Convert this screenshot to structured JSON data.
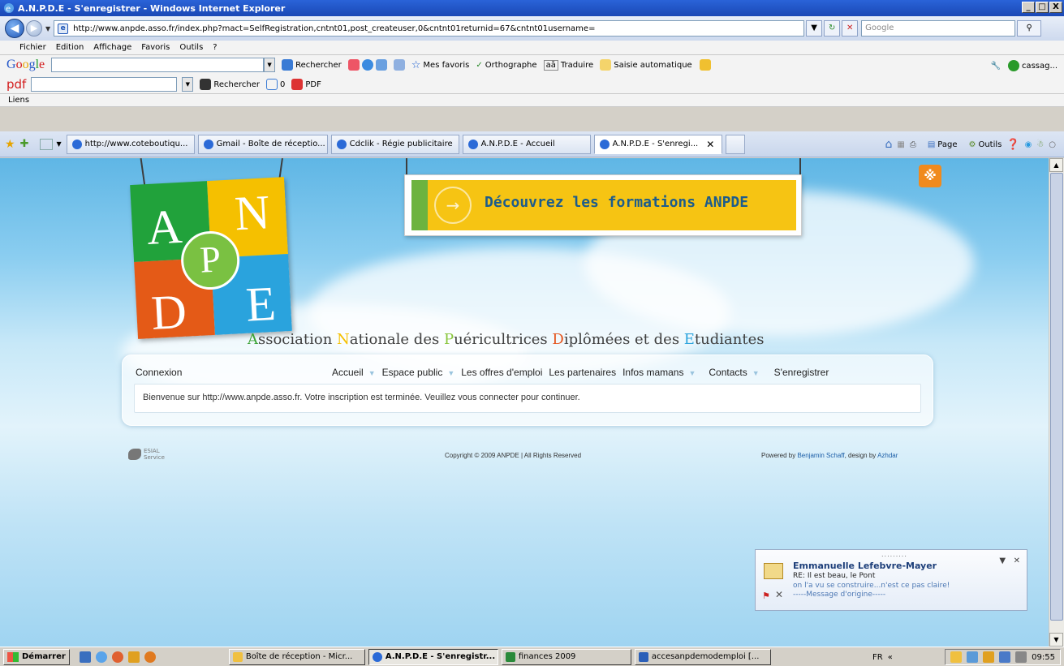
{
  "window": {
    "title": "A.N.P.D.E - S'enregistrer - Windows Internet Explorer",
    "controls": [
      "_",
      "□",
      "X"
    ]
  },
  "address": {
    "url": "http://www.anpde.asso.fr/index.php?mact=SelfRegistration,cntnt01,post_createuser,0&cntnt01returnid=67&cntnt01username=",
    "search_placeholder": "Google"
  },
  "menu": [
    "Fichier",
    "Edition",
    "Affichage",
    "Favoris",
    "Outils",
    "?"
  ],
  "google_toolbar": {
    "search_label": "Rechercher",
    "favorites_label": "Mes favoris",
    "spell_label": "Orthographe",
    "translate_label": "Traduire",
    "autofill_label": "Saisie automatique",
    "account_label": "cassag..."
  },
  "pdf_toolbar": {
    "brand": "pdf",
    "search_label": "Rechercher",
    "count": "0",
    "pdf_label": "PDF"
  },
  "links_label": "Liens",
  "tabs": [
    {
      "label": "http://www.coteboutiqu..."
    },
    {
      "label": "Gmail - Boîte de réceptio..."
    },
    {
      "label": "Cdclik - Régie publicitaire"
    },
    {
      "label": "A.N.P.D.E - Accueil"
    },
    {
      "label": "A.N.P.D.E - S'enregi..."
    }
  ],
  "command_bar": {
    "page_label": "Page",
    "tools_label": "Outils"
  },
  "page": {
    "logo_letters": {
      "a": "A",
      "n": "N",
      "p": "P",
      "d": "D",
      "e": "E"
    },
    "banner_text": "Découvrez les formations ANPDE",
    "title_parts": {
      "p1_initial": "A",
      "p1_rest": "ssociation ",
      "p2_initial": "N",
      "p2_rest": "ationale des ",
      "p3_initial": "P",
      "p3_rest": "uéricultrices ",
      "p4_initial": "D",
      "p4_rest": "iplômées et des ",
      "p5_initial": "E",
      "p5_rest": "tudiantes"
    },
    "connexion_label": "Connexion",
    "nav": {
      "accueil": "Accueil",
      "espace_public": "Espace public",
      "offres": "Les offres d'emploi",
      "partenaires": "Les partenaires",
      "infos": "Infos mamans",
      "contacts": "Contacts",
      "enregistrer": "S'enregistrer"
    },
    "message": "Bienvenue sur http://www.anpde.asso.fr. Votre inscription est terminée. Veuillez vous connecter pour continuer.",
    "esial_label": "ESIAL",
    "esial_sub": "Service",
    "copyright": "Copyright © 2009 ANPDE | All Rights Reserved",
    "powered_prefix": "Powered by ",
    "powered_name": "Benjamin Schaff",
    "powered_design": ", design by ",
    "designer": "Azhdar"
  },
  "notification": {
    "sender": "Emmanuelle Lefebvre-Mayer",
    "subject": "RE: Il est beau, le Pont",
    "line3": "on l'a vu se construire...n'est ce pas claire!",
    "line4": "-----Message d'origine-----"
  },
  "taskbar": {
    "start_label": "Démarrer",
    "items": [
      {
        "label": "Boîte de réception - Micr..."
      },
      {
        "label": "A.N.P.D.E - S'enregistr..."
      },
      {
        "label": "finances 2009"
      },
      {
        "label": "accesanpdemodemploi [..."
      }
    ],
    "lang": "FR",
    "clock": "09:55"
  },
  "colors": {
    "logo_green": "#21a23b",
    "logo_yellow": "#f5c000",
    "logo_orange": "#e45a17",
    "logo_blue": "#2aa3dd",
    "banner_yellow": "#f6c413"
  }
}
